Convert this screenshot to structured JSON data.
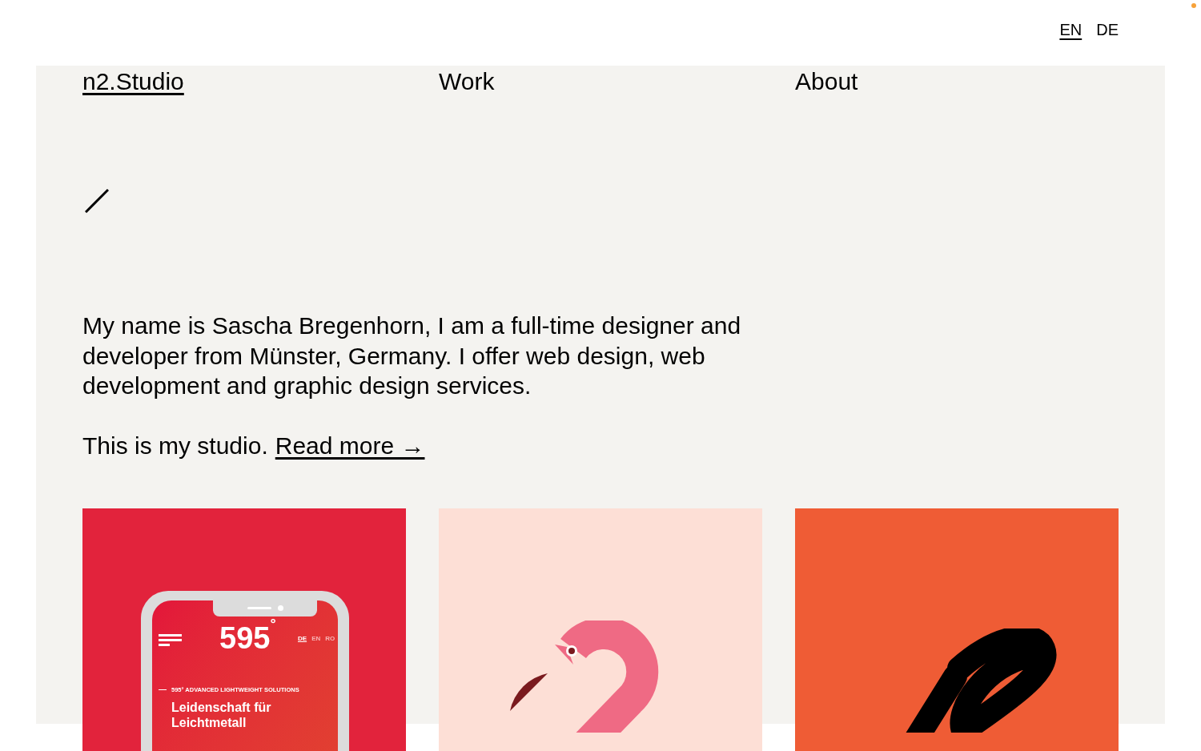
{
  "languages": [
    {
      "label": "EN",
      "selected": true
    },
    {
      "label": "DE",
      "selected": false
    }
  ],
  "nav": [
    {
      "label": "n2.Studio",
      "selected": true
    },
    {
      "label": "Work",
      "selected": false
    },
    {
      "label": "About",
      "selected": false
    }
  ],
  "intro": {
    "text": "My name is Sascha Bregenhorn, I am a full-time designer and developer from Münster, Germany. I offer web design, web development and graphic design services.",
    "lead": "This is my studio.",
    "link": "Read more →"
  },
  "projects": [
    {
      "kind": "phone",
      "color": "#e2233c",
      "mockup": {
        "logo": "595",
        "degree": "°",
        "languages": [
          {
            "label": "DE",
            "selected": true
          },
          {
            "label": "EN",
            "selected": false
          },
          {
            "label": "RO",
            "selected": false
          }
        ],
        "tagline": "595° ADVANCED LIGHTWEIGHT SOLUTIONS",
        "headline": "Leidenschaft für Leichtmetall"
      }
    },
    {
      "kind": "flamingo",
      "color": "#fddfd6"
    },
    {
      "kind": "ampersand",
      "color": "#ef5c35"
    }
  ]
}
